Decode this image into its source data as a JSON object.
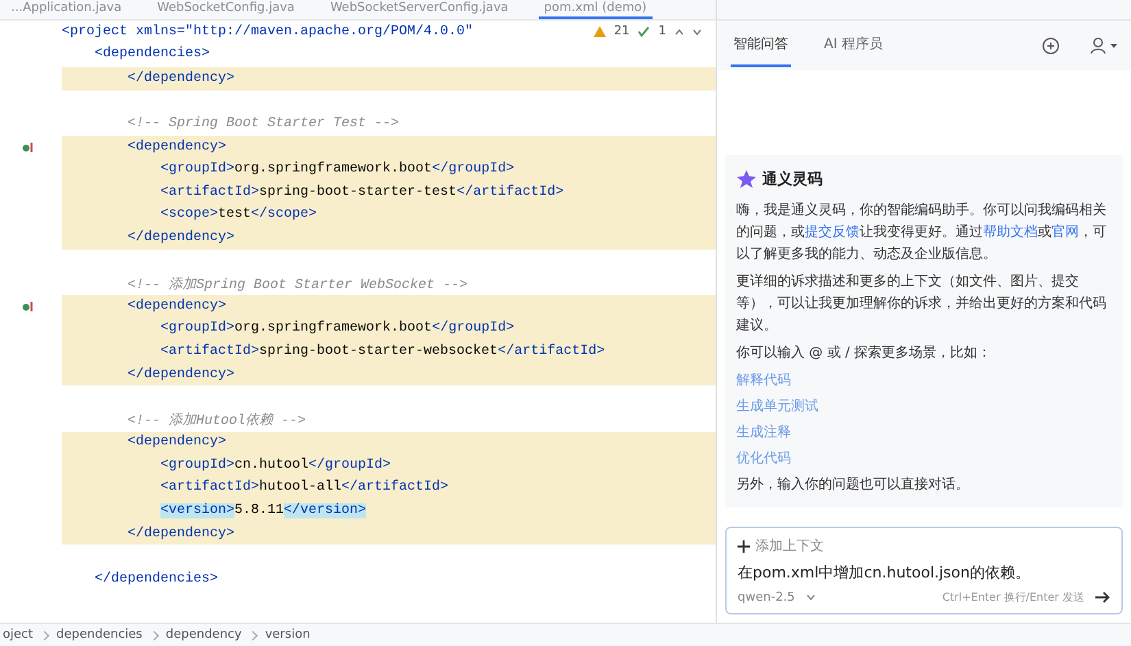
{
  "editor_tabs": [
    {
      "label": "...Application.java",
      "selected": false
    },
    {
      "label": "WebSocketConfig.java",
      "selected": false
    },
    {
      "label": "WebSocketServerConfig.java",
      "selected": false
    },
    {
      "label": "pom.xml (demo)",
      "selected": true
    }
  ],
  "sticky_lines": [
    "<project xmlns=\"http://maven.apache.org/POM/4.0.0\"",
    "    <dependencies>"
  ],
  "inspections": {
    "warnings": "21",
    "passed": "1"
  },
  "code_lines": [
    {
      "kind": "code",
      "text": "        </dependency>",
      "highlighted": true,
      "gutter_mark": false
    },
    {
      "kind": "blank",
      "highlighted": false,
      "gutter_mark": false
    },
    {
      "kind": "comment",
      "text": "        <!-- Spring Boot Starter Test -->",
      "highlighted": false,
      "gutter_mark": false
    },
    {
      "kind": "code",
      "text": "        <dependency>",
      "highlighted": true,
      "gutter_mark": true
    },
    {
      "kind": "code",
      "text": "            <groupId>org.springframework.boot</groupId>",
      "highlighted": true,
      "gutter_mark": false
    },
    {
      "kind": "code",
      "text": "            <artifactId>spring-boot-starter-test</artifactId>",
      "highlighted": true,
      "gutter_mark": false
    },
    {
      "kind": "code",
      "text": "            <scope>test</scope>",
      "highlighted": true,
      "gutter_mark": false
    },
    {
      "kind": "code",
      "text": "        </dependency>",
      "highlighted": true,
      "gutter_mark": false
    },
    {
      "kind": "blank",
      "highlighted": false,
      "gutter_mark": false
    },
    {
      "kind": "comment",
      "text": "        <!-- 添加Spring Boot Starter WebSocket -->",
      "highlighted": false,
      "gutter_mark": false
    },
    {
      "kind": "code",
      "text": "        <dependency>",
      "highlighted": true,
      "gutter_mark": true
    },
    {
      "kind": "code",
      "text": "            <groupId>org.springframework.boot</groupId>",
      "highlighted": true,
      "gutter_mark": false
    },
    {
      "kind": "code",
      "text": "            <artifactId>spring-boot-starter-websocket</artifactId>",
      "highlighted": true,
      "gutter_mark": false
    },
    {
      "kind": "code",
      "text": "        </dependency>",
      "highlighted": true,
      "gutter_mark": false
    },
    {
      "kind": "blank",
      "highlighted": false,
      "gutter_mark": false
    },
    {
      "kind": "comment",
      "text": "        <!-- 添加Hutool依赖 -->",
      "highlighted": false,
      "gutter_mark": false
    },
    {
      "kind": "code",
      "text": "        <dependency>",
      "highlighted": true,
      "gutter_mark": false
    },
    {
      "kind": "code",
      "text": "            <groupId>cn.hutool</groupId>",
      "highlighted": true,
      "gutter_mark": false
    },
    {
      "kind": "code",
      "text": "            <artifactId>hutool-all</artifactId>",
      "highlighted": true,
      "gutter_mark": false
    },
    {
      "kind": "tokens",
      "tokens": [
        {
          "text": "<version>",
          "matched": true
        },
        {
          "text": "5.8.11",
          "matched": false
        },
        {
          "text": "</version>",
          "matched": true
        }
      ],
      "highlighted": true,
      "gutter_mark": false
    },
    {
      "kind": "code",
      "text": "        </dependency>",
      "highlighted": true,
      "gutter_mark": false
    },
    {
      "kind": "blank",
      "highlighted": false,
      "gutter_mark": false
    },
    {
      "kind": "code",
      "text": "    </dependencies>",
      "highlighted": false,
      "gutter_mark": false
    }
  ],
  "breadcrumbs": [
    "oject",
    "dependencies",
    "dependency",
    "version"
  ],
  "assistant": {
    "tabs": [
      {
        "label": "智能问答",
        "selected": true
      },
      {
        "label": "AI 程序员",
        "selected": false
      }
    ],
    "title": "通义灵码",
    "intro": [
      {
        "kind": "text",
        "text": "嗨，我是通义灵码，你的智能编码助手。你可以问我编码相关的问题，或"
      },
      {
        "kind": "link",
        "text": "提交反馈"
      },
      {
        "kind": "text",
        "text": "让我变得更好。通过"
      },
      {
        "kind": "link",
        "text": "帮助文档"
      },
      {
        "kind": "text",
        "text": "或"
      },
      {
        "kind": "link",
        "text": "官网"
      },
      {
        "kind": "text",
        "text": "，可以了解更多我的能力、动态及企业版信息。"
      }
    ],
    "paragraphs": [
      "更详细的诉求描述和更多的上下文（如文件、图片、提交等），可以让我更加理解你的诉求，并给出更好的方案和代码建议。",
      "你可以输入 @ 或 / 探索更多场景，比如："
    ],
    "suggestions": [
      "解释代码",
      "生成单元测试",
      "生成注释",
      "优化代码"
    ],
    "footer": "另外，输入你的问题也可以直接对话。",
    "input": {
      "context_label": "添加上下文",
      "value": "在pom.xml中增加cn.hutool.json的依赖。",
      "model": "qwen-2.5",
      "hint": "Ctrl+Enter 换行/Enter 发送"
    }
  }
}
